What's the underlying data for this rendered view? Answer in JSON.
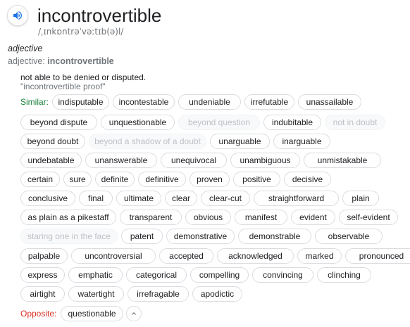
{
  "entry": {
    "word": "incontrovertible",
    "phonetic": "/ˌɪnkɒntrəˈvəːtɪb(ə)l/",
    "part_of_speech": "adjective",
    "form_label": "adjective:",
    "form_word": "incontrovertible",
    "definition": "not able to be denied or disputed.",
    "example": "\"incontrovertible proof\""
  },
  "labels": {
    "similar": "Similar:",
    "opposite": "Opposite:"
  },
  "similar_rows": [
    [
      {
        "text": "indisputable",
        "muted": false
      },
      {
        "text": "incontestable",
        "muted": false
      },
      {
        "text": "undeniable",
        "muted": false
      },
      {
        "text": "irrefutable",
        "muted": false
      },
      {
        "text": "unassailable",
        "muted": false
      }
    ],
    [
      {
        "text": "beyond dispute",
        "muted": false
      },
      {
        "text": "unquestionable",
        "muted": false
      },
      {
        "text": "beyond question",
        "muted": true
      },
      {
        "text": "indubitable",
        "muted": false
      },
      {
        "text": "not in doubt",
        "muted": true
      }
    ],
    [
      {
        "text": "beyond doubt",
        "muted": false
      },
      {
        "text": "beyond a shadow of a doubt",
        "muted": true
      },
      {
        "text": "unarguable",
        "muted": false
      },
      {
        "text": "inarguable",
        "muted": false
      }
    ],
    [
      {
        "text": "undebatable",
        "muted": false
      },
      {
        "text": "unanswerable",
        "muted": false
      },
      {
        "text": "unequivocal",
        "muted": false
      },
      {
        "text": "unambiguous",
        "muted": false
      },
      {
        "text": "unmistakable",
        "muted": false
      }
    ],
    [
      {
        "text": "certain",
        "muted": false
      },
      {
        "text": "sure",
        "muted": false
      },
      {
        "text": "definite",
        "muted": false
      },
      {
        "text": "definitive",
        "muted": false
      },
      {
        "text": "proven",
        "muted": false
      },
      {
        "text": "positive",
        "muted": false
      },
      {
        "text": "decisive",
        "muted": false
      }
    ],
    [
      {
        "text": "conclusive",
        "muted": false
      },
      {
        "text": "final",
        "muted": false
      },
      {
        "text": "ultimate",
        "muted": false
      },
      {
        "text": "clear",
        "muted": false
      },
      {
        "text": "clear-cut",
        "muted": false
      },
      {
        "text": "straightforward",
        "muted": false
      },
      {
        "text": "plain",
        "muted": false
      }
    ],
    [
      {
        "text": "as plain as a pikestaff",
        "muted": false
      },
      {
        "text": "transparent",
        "muted": false
      },
      {
        "text": "obvious",
        "muted": false
      },
      {
        "text": "manifest",
        "muted": false
      },
      {
        "text": "evident",
        "muted": false
      },
      {
        "text": "self-evident",
        "muted": false
      }
    ],
    [
      {
        "text": "staring one in the face",
        "muted": true
      },
      {
        "text": "patent",
        "muted": false
      },
      {
        "text": "demonstrative",
        "muted": false
      },
      {
        "text": "demonstrable",
        "muted": false
      },
      {
        "text": "observable",
        "muted": false
      }
    ],
    [
      {
        "text": "palpable",
        "muted": false
      },
      {
        "text": "uncontroversial",
        "muted": false
      },
      {
        "text": "accepted",
        "muted": false
      },
      {
        "text": "acknowledged",
        "muted": false
      },
      {
        "text": "marked",
        "muted": false
      },
      {
        "text": "pronounced",
        "muted": false
      }
    ],
    [
      {
        "text": "express",
        "muted": false
      },
      {
        "text": "emphatic",
        "muted": false
      },
      {
        "text": "categorical",
        "muted": false
      },
      {
        "text": "compelling",
        "muted": false
      },
      {
        "text": "convincing",
        "muted": false
      },
      {
        "text": "clinching",
        "muted": false
      }
    ],
    [
      {
        "text": "airtight",
        "muted": false
      },
      {
        "text": "watertight",
        "muted": false
      },
      {
        "text": "irrefragable",
        "muted": false
      },
      {
        "text": "apodictic",
        "muted": false
      }
    ]
  ],
  "opposite": [
    {
      "text": "questionable",
      "muted": false
    }
  ],
  "icons": {
    "speaker": "speaker-icon",
    "collapse": "chevron-up-icon"
  },
  "colors": {
    "similar_label": "#188038",
    "opposite_label": "#d93025",
    "speaker_blue": "#1a73e8",
    "chip_border": "#dadce0",
    "muted_text": "#bdc1c6"
  }
}
